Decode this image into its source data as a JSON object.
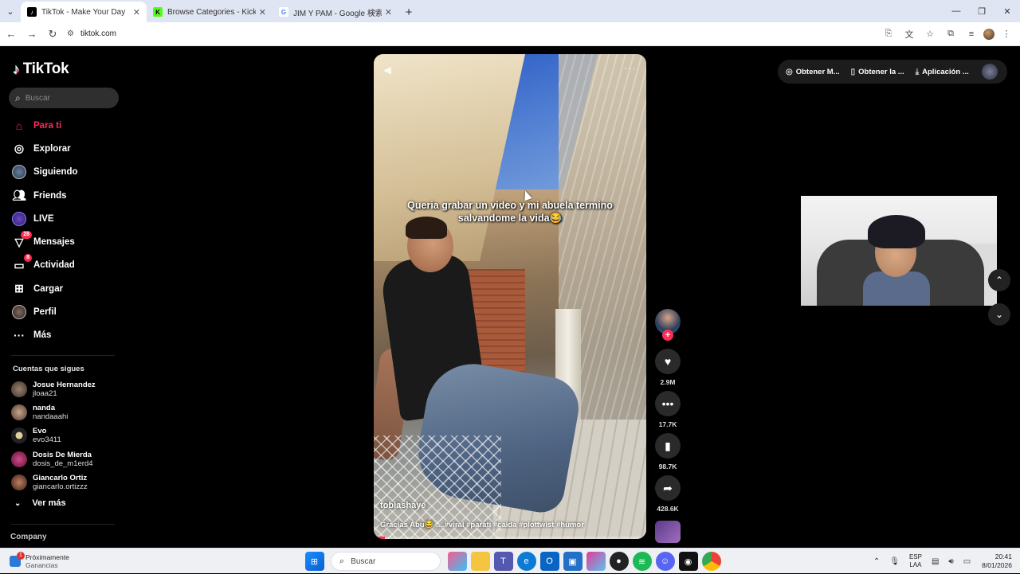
{
  "browser": {
    "tabs": [
      {
        "title": "TikTok - Make Your Day",
        "favicon": "tiktok-favicon",
        "active": true
      },
      {
        "title": "Browse Categories - Kick Stream",
        "favicon": "kick-favicon",
        "active": false
      },
      {
        "title": "JIM Y PAM - Google 検索",
        "favicon": "google-favicon",
        "active": false
      }
    ],
    "url": "tiktok.com"
  },
  "sidebar": {
    "logo_text": "TikTok",
    "search_placeholder": "Buscar",
    "nav": [
      {
        "label": "Para ti",
        "icon": "home-icon",
        "active": true
      },
      {
        "label": "Explorar",
        "icon": "compass-icon"
      },
      {
        "label": "Siguiendo",
        "icon": "following-avatar-icon"
      },
      {
        "label": "Friends",
        "icon": "friends-icon"
      },
      {
        "label": "LIVE",
        "icon": "live-icon"
      },
      {
        "label": "Mensajes",
        "icon": "messages-icon",
        "badge": "28"
      },
      {
        "label": "Actividad",
        "icon": "activity-icon",
        "badge": "8"
      },
      {
        "label": "Cargar",
        "icon": "upload-icon"
      },
      {
        "label": "Perfil",
        "icon": "profile-icon"
      },
      {
        "label": "Más",
        "icon": "more-icon"
      }
    ],
    "following_title": "Cuentas que sigues",
    "following": [
      {
        "name": "Josue Hernandez",
        "handle": "jloaa21",
        "avatar_color": "#6b5a4a"
      },
      {
        "name": "nanda",
        "handle": "nandaaahi",
        "avatar_color": "#8a6a5a"
      },
      {
        "name": "Evo",
        "handle": "evo3411",
        "avatar_color": "#3a3a3a"
      },
      {
        "name": "Dosis De Mierda",
        "handle": "dosis_de_m1erd4",
        "avatar_color": "#a8326a"
      },
      {
        "name": "Giancarlo Ortiz",
        "handle": "giancarlo.ortizzz",
        "avatar_color": "#7a4a3a"
      }
    ],
    "see_more": "Ver más",
    "company": "Company"
  },
  "video": {
    "overlay_text": "Queria grabar un video y mi abuela termino salvandome la vida😂",
    "author": "tobiashaye",
    "description": "Gracias Abu😂 ....#viral #parati #caida #plottwist #humor",
    "progress": 0.04
  },
  "actions": {
    "likes": "2.9M",
    "comments": "17.7K",
    "saves": "98.7K",
    "shares": "428.6K"
  },
  "topbar": {
    "items": [
      {
        "label": "Obtener M...",
        "icon": "coin-icon"
      },
      {
        "label": "Obtener la ...",
        "icon": "phone-icon"
      },
      {
        "label": "Aplicación ...",
        "icon": "download-icon"
      }
    ]
  },
  "taskbar": {
    "weather_line1": "Próximamente",
    "weather_line2": "Ganancias",
    "weather_badge": "1",
    "search": "Buscar",
    "lang1": "ESP",
    "lang2": "LAA",
    "time": "20:41",
    "date": "8/01/2026"
  }
}
